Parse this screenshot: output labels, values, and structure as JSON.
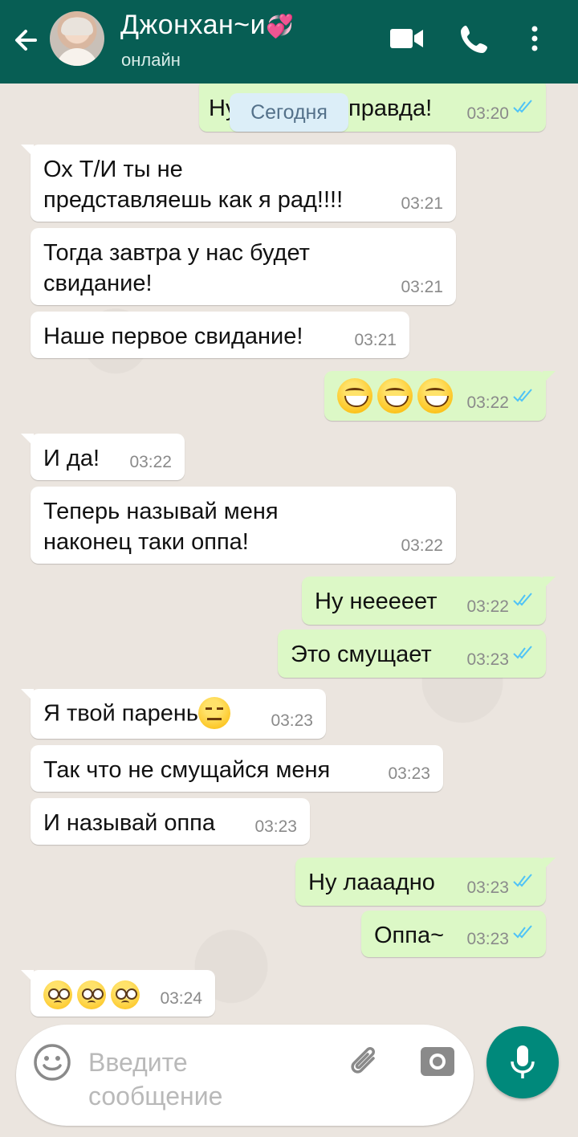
{
  "header": {
    "contact_name": "Джонхан~и",
    "status": "онлайн",
    "icons": [
      "back-arrow-icon",
      "video-call-icon",
      "voice-call-icon",
      "more-options-icon"
    ]
  },
  "date_chip": "Сегодня",
  "messages": [
    {
      "dir": "out",
      "text": "Ну да, правда!",
      "visible_left": "Ну",
      "visible_right": "правда!",
      "time": "03:20",
      "read": true
    },
    {
      "dir": "in",
      "text": "Ох Т/И ты не представляешь как я рад!!!!",
      "lines": [
        "Ох Т/И ты не",
        "представляешь как я рад!!!!"
      ],
      "time": "03:21"
    },
    {
      "dir": "in",
      "text": "Тогда завтра у нас будет свидание!",
      "lines": [
        "Тогда завтра у нас будет",
        "свидание!"
      ],
      "time": "03:21"
    },
    {
      "dir": "in",
      "text": "Наше первое свидание!",
      "time": "03:21"
    },
    {
      "dir": "out",
      "emoji": [
        "grinning-face",
        "grinning-face",
        "grinning-face"
      ],
      "time": "03:22",
      "read": true
    },
    {
      "dir": "in",
      "text": "И да!",
      "time": "03:22"
    },
    {
      "dir": "in",
      "text": "Теперь называй меня наконец таки оппа!",
      "lines": [
        "Теперь называй меня",
        "наконец таки оппа!"
      ],
      "time": "03:22"
    },
    {
      "dir": "out",
      "text": "Ну неееeет",
      "display": "Ну неееeет",
      "time": "03:22",
      "read": true
    },
    {
      "dir": "out",
      "text": "Это смущает",
      "time": "03:23",
      "read": true
    },
    {
      "dir": "in",
      "text": "Я твой парень",
      "emoji": [
        "expressionless-face"
      ],
      "time": "03:23"
    },
    {
      "dir": "in",
      "text": "Так что не смущайся меня",
      "time": "03:23"
    },
    {
      "dir": "in",
      "text": "И называй оппа",
      "time": "03:23"
    },
    {
      "dir": "out",
      "text": "Ну лааадно",
      "time": "03:23",
      "read": true
    },
    {
      "dir": "out",
      "text": "Оппа~",
      "time": "03:23",
      "read": true
    },
    {
      "dir": "in",
      "emoji": [
        "pleading-face",
        "pleading-face",
        "pleading-face"
      ],
      "time": "03:24"
    }
  ],
  "input": {
    "placeholder_lines": [
      "Введите",
      "сообщение"
    ],
    "icons": [
      "emoji-icon",
      "attach-icon",
      "camera-icon",
      "microphone-icon"
    ]
  },
  "colors": {
    "header": "#075e54",
    "outgoing_bubble": "#dcf8c6",
    "incoming_bubble": "#ffffff",
    "read_ticks": "#4fc3f7",
    "mic_button": "#00897b"
  }
}
